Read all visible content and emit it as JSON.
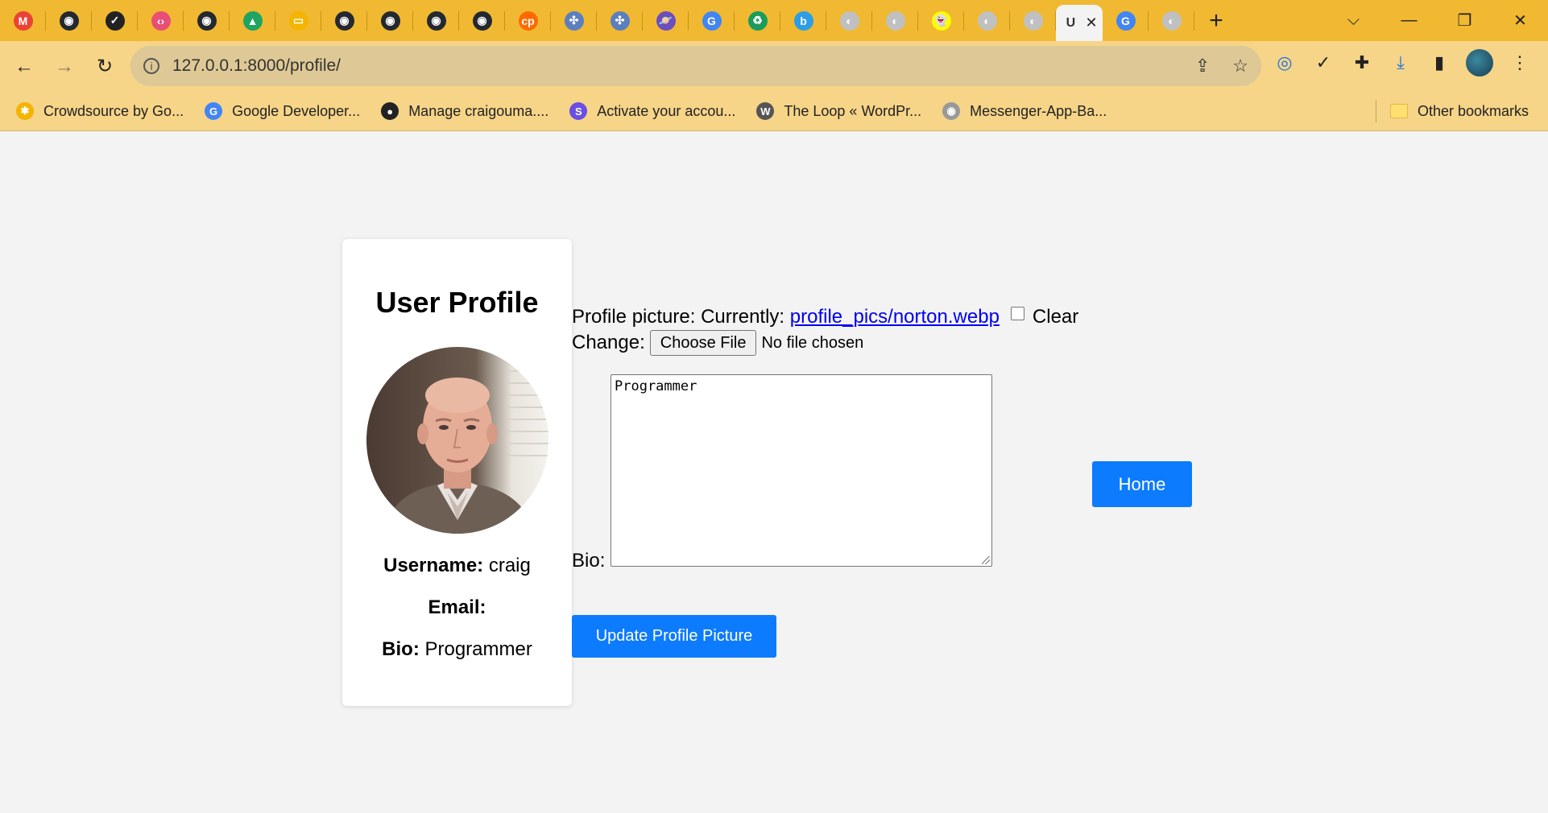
{
  "browser": {
    "tab_favicons": [
      {
        "icon": "gmail-icon",
        "color": "#ea4335",
        "glyph": "M"
      },
      {
        "icon": "github-icon",
        "color": "#24292f",
        "glyph": "◉"
      },
      {
        "icon": "check-circle-icon",
        "color": "#222222",
        "glyph": "✓"
      },
      {
        "icon": "code-icon",
        "color": "#e94e77",
        "glyph": "‹›"
      },
      {
        "icon": "github-icon",
        "color": "#24292f",
        "glyph": "◉"
      },
      {
        "icon": "google-drive-icon",
        "color": "#1fa463",
        "glyph": "▲"
      },
      {
        "icon": "google-slides-icon",
        "color": "#f4b400",
        "glyph": "▭"
      },
      {
        "icon": "github-icon",
        "color": "#24292f",
        "glyph": "◉"
      },
      {
        "icon": "github-icon",
        "color": "#24292f",
        "glyph": "◉"
      },
      {
        "icon": "github-icon",
        "color": "#24292f",
        "glyph": "◉"
      },
      {
        "icon": "github-icon",
        "color": "#24292f",
        "glyph": "◉"
      },
      {
        "icon": "codepen-icon",
        "color": "#ff6a00",
        "glyph": "cp"
      },
      {
        "icon": "network-icon",
        "color": "#5b7fbf",
        "glyph": "✣"
      },
      {
        "icon": "network-icon",
        "color": "#5b7fbf",
        "glyph": "✣"
      },
      {
        "icon": "planet-icon",
        "color": "#6b4fbf",
        "glyph": "🪐"
      },
      {
        "icon": "google-icon",
        "color": "#4285f4",
        "glyph": "G"
      },
      {
        "icon": "recycle-icon",
        "color": "#1a9c5a",
        "glyph": "♻"
      },
      {
        "icon": "b-icon",
        "color": "#2b9ee6",
        "glyph": "b"
      },
      {
        "icon": "globe-icon",
        "color": "#c0c0c0",
        "glyph": "◐"
      },
      {
        "icon": "globe-icon",
        "color": "#c0c0c0",
        "glyph": "◐"
      },
      {
        "icon": "snapchat-icon",
        "color": "#fffc00",
        "glyph": "👻"
      },
      {
        "icon": "globe-icon",
        "color": "#c0c0c0",
        "glyph": "◐"
      },
      {
        "icon": "globe-icon",
        "color": "#c0c0c0",
        "glyph": "◐"
      }
    ],
    "active_tab": {
      "title": "U",
      "close": "✕"
    },
    "after_tabs": [
      {
        "icon": "google-icon",
        "color": "#4285f4",
        "glyph": "G"
      },
      {
        "icon": "globe-icon",
        "color": "#c0c0c0",
        "glyph": "◐"
      }
    ],
    "new_tab": "+",
    "window": {
      "chevron": "⌵",
      "minimize": "—",
      "restore": "❐",
      "close": "✕"
    },
    "nav": {
      "back": "←",
      "forward": "→",
      "reload": "↻"
    },
    "url": "127.0.0.1:8000/profile/",
    "bookmarks": [
      {
        "label": "Crowdsource by Go...",
        "icon": "crowdsource-icon",
        "color": "#f4b400",
        "glyph": "✱"
      },
      {
        "label": "Google Developer...",
        "icon": "google-icon",
        "color": "#4285f4",
        "glyph": "G"
      },
      {
        "label": "Manage craigouma....",
        "icon": "globe-icon",
        "color": "#222222",
        "glyph": "●"
      },
      {
        "label": "Activate your accou...",
        "icon": "s-icon",
        "color": "#6a4ee6",
        "glyph": "S"
      },
      {
        "label": "The Loop « WordPr...",
        "icon": "wordpress-icon",
        "color": "#555555",
        "glyph": "W"
      },
      {
        "label": "Messenger-App-Ba...",
        "icon": "github-icon",
        "color": "#999999",
        "glyph": "◉"
      }
    ],
    "other_bookmarks": "Other bookmarks"
  },
  "profile_card": {
    "title": "User Profile",
    "username_label": "Username:",
    "username": "craig",
    "email_label": "Email:",
    "email": "",
    "bio_label": "Bio:",
    "bio": "Programmer"
  },
  "form": {
    "picture_label": "Profile picture: Currently:",
    "picture_link": "profile_pics/norton.webp",
    "clear_label": "Clear",
    "change_label": "Change:",
    "choose_file": "Choose File",
    "no_file": "No file chosen",
    "bio_field_label": "Bio:",
    "bio_value": "Programmer",
    "submit": "Update Profile Picture",
    "home": "Home"
  },
  "colors": {
    "accent": "#0d7bfd",
    "tabstrip": "#f0b931",
    "toolbar": "#f6d488"
  }
}
